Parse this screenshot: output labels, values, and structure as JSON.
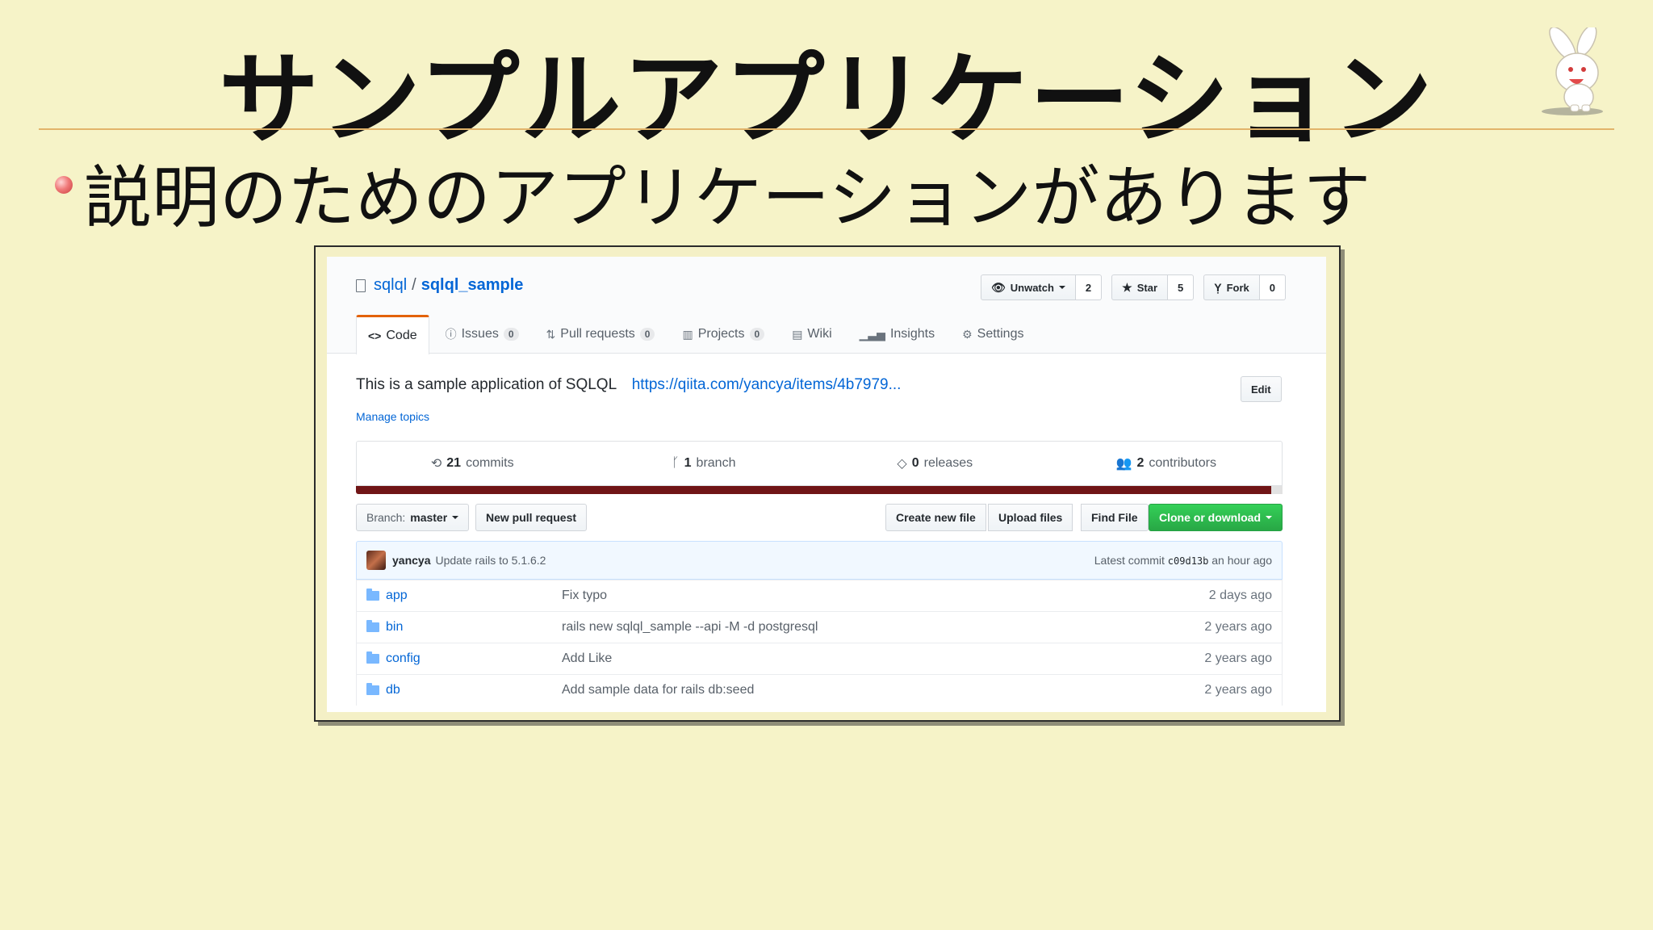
{
  "slide": {
    "title": "サンプルアプリケーション",
    "bullet": "説明のためのアプリケーションがあります"
  },
  "repo": {
    "owner": "sqlql",
    "separator": "/",
    "name": "sqlql_sample",
    "actions": {
      "watch_label": "Unwatch",
      "watch_count": "2",
      "star_label": "Star",
      "star_count": "5",
      "fork_label": "Fork",
      "fork_count": "0"
    },
    "tabs": [
      {
        "label": "Code",
        "icon": "code-icon",
        "count": null,
        "selected": true
      },
      {
        "label": "Issues",
        "icon": "issue-icon",
        "count": "0"
      },
      {
        "label": "Pull requests",
        "icon": "pull-request-icon",
        "count": "0"
      },
      {
        "label": "Projects",
        "icon": "project-icon",
        "count": "0"
      },
      {
        "label": "Wiki",
        "icon": "wiki-icon"
      },
      {
        "label": "Insights",
        "icon": "graph-icon"
      },
      {
        "label": "Settings",
        "icon": "gear-icon"
      }
    ],
    "description": "This is a sample application of SQLQL",
    "homepage": "https://qiita.com/yancya/items/4b7979...",
    "manage_topics": "Manage topics",
    "edit_label": "Edit",
    "numbers": {
      "commits_count": "21",
      "commits_label": "commits",
      "branch_count": "1",
      "branch_label": "branch",
      "releases_count": "0",
      "releases_label": "releases",
      "contributors_count": "2",
      "contributors_label": "contributors"
    },
    "language_color": "#701516",
    "file_nav": {
      "branch_prefix": "Branch:",
      "branch_name": "master",
      "new_pr": "New pull request",
      "create_file": "Create new file",
      "upload_files": "Upload files",
      "find_file": "Find File",
      "clone": "Clone or download"
    },
    "latest_commit": {
      "author": "yancya",
      "message": "Update rails to 5.1.6.2",
      "prefix": "Latest commit",
      "sha": "c09d13b",
      "age": "an hour ago"
    },
    "files": [
      {
        "name": "app",
        "message": "Fix typo",
        "age": "2 days ago"
      },
      {
        "name": "bin",
        "message": "rails new sqlql_sample --api -M -d postgresql",
        "age": "2 years ago"
      },
      {
        "name": "config",
        "message": "Add Like",
        "age": "2 years ago"
      },
      {
        "name": "db",
        "message": "Add sample data for rails db:seed",
        "age": "2 years ago"
      }
    ]
  }
}
